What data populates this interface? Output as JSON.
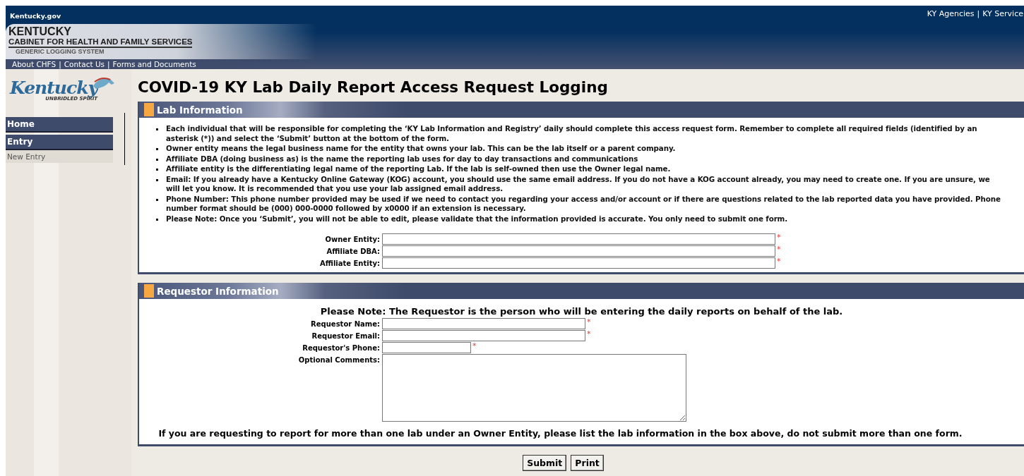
{
  "header": {
    "site_link": "Kentucky.gov",
    "top_links": [
      "KY Agencies",
      "KY Service"
    ],
    "separator": "|",
    "agency": "KENTUCKY",
    "department": "CABINET FOR HEALTH AND FAMILY SERVICES",
    "system": "GENERIC LOGGING SYSTEM",
    "nav_links": [
      "About CHFS",
      "Contact Us",
      "Forms and Documents"
    ]
  },
  "sidebar": {
    "logo": {
      "wordmark": "Kentucky",
      "tagline": "UNBRIDLED SPIRIT"
    },
    "items": [
      {
        "label": "Home",
        "kind": "section"
      },
      {
        "label": "Entry",
        "kind": "section"
      },
      {
        "label": "New Entry",
        "kind": "link"
      }
    ]
  },
  "title": "COVID-19 KY Lab Daily Report Access Request Logging",
  "sections": [
    {
      "title": "Lab Information",
      "bullets": [
        "Each individual that will be responsible for completing the ‘KY Lab Information and Registry’ daily should complete this access request form. Remember to complete all required fields (identified by an asterisk (*)) and select the ‘Submit’ button at the bottom of the form.",
        "Owner entity means the legal business name for the entity that owns your lab. This can be the lab itself or a parent company.",
        "Affiliate DBA (doing business as) is the name the reporting lab uses for day to day transactions and communications",
        "Affiliate entity is the differentiating legal name of the reporting Lab. If the lab is self-owned then use the Owner legal name.",
        "Email: If you already have a Kentucky Online Gateway (KOG) account, you should use the same email address. If you do not have a KOG account already, you may need to create one. If you are unsure, we will let you know. It is recommended that you use your lab assigned email address.",
        "Phone Number: This phone number provided may be used if we need to contact you regarding your access and/or account or if there are questions related to the lab reported data you have provided. Phone number format should be (000) 000-0000 followed by x0000 if an extension is necessary.",
        "Please Note: Once you ‘Submit’, you will not be able to edit, please validate that the information provided is accurate. You only need to submit one form."
      ],
      "fields": [
        {
          "label": "Owner Entity:",
          "kind": "wide",
          "required_mark": "*"
        },
        {
          "label": "Affiliate DBA:",
          "kind": "wide",
          "required_mark": "*"
        },
        {
          "label": "Affiliate Entity:",
          "kind": "wide",
          "required_mark": "*"
        }
      ]
    },
    {
      "title": "Requestor Information",
      "note": "Please Note: The Requestor is the person who will be entering the daily reports on behalf of the lab.",
      "fields": [
        {
          "label": "Requestor Name:",
          "kind": "medium",
          "required_mark": "*"
        },
        {
          "label": "Requestor Email:",
          "kind": "medium",
          "required_mark": "*"
        },
        {
          "label": "Requestor's Phone:",
          "kind": "short",
          "required_mark": "*"
        },
        {
          "label": "Optional Comments:",
          "kind": "textarea"
        }
      ],
      "footer_note": "If you are requesting to report for more than one lab under an Owner Entity, please list the lab information in the box above, do not submit more than one form."
    }
  ],
  "buttons": [
    "Submit",
    "Print"
  ]
}
